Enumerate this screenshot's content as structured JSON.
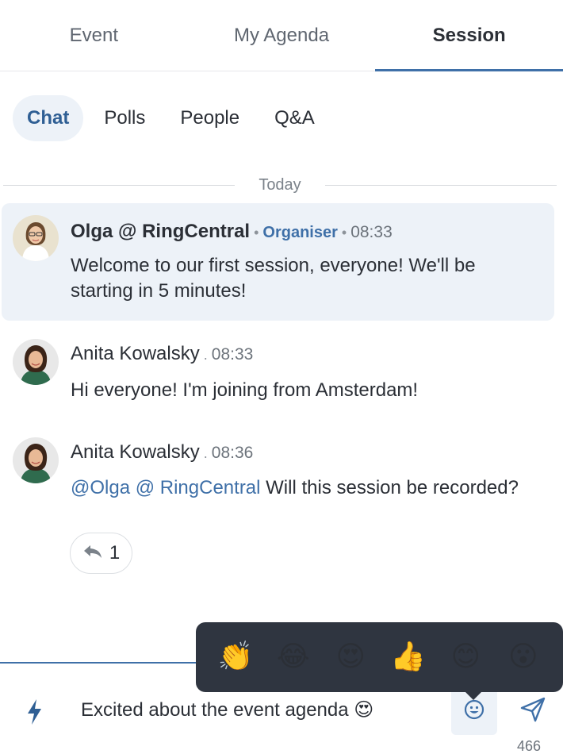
{
  "top_tabs": [
    {
      "label": "Event"
    },
    {
      "label": "My Agenda"
    },
    {
      "label": "Session"
    }
  ],
  "sub_tabs": [
    {
      "label": "Chat"
    },
    {
      "label": "Polls"
    },
    {
      "label": "People"
    },
    {
      "label": "Q&A"
    }
  ],
  "date_divider": "Today",
  "messages": [
    {
      "author": "Olga @ RingCentral",
      "role": "Organiser",
      "time": "08:33",
      "text": "Welcome to our first session, everyone! We'll be starting in 5 minutes!"
    },
    {
      "author": "Anita Kowalsky",
      "time": "08:33",
      "text": "Hi everyone! I'm joining from Amsterdam!"
    },
    {
      "author": "Anita Kowalsky",
      "time": "08:36",
      "mention": "@Olga @ RingCentral",
      "text": " Will this session be recorded?",
      "reply_count": "1"
    }
  ],
  "emoji_picker": [
    "👏",
    "😂",
    "😍",
    "👍",
    "😊",
    "😮"
  ],
  "composer": {
    "value": "Excited about the event agenda 😍",
    "char_count": "466"
  },
  "icons": {
    "quick_action": "bolt-icon",
    "emoji": "smiley-icon",
    "send": "send-icon",
    "reply": "reply-arrow-icon"
  },
  "colors": {
    "accent": "#3f70a8",
    "highlight_bg": "#edf2f8",
    "popover_bg": "#2f3540"
  }
}
